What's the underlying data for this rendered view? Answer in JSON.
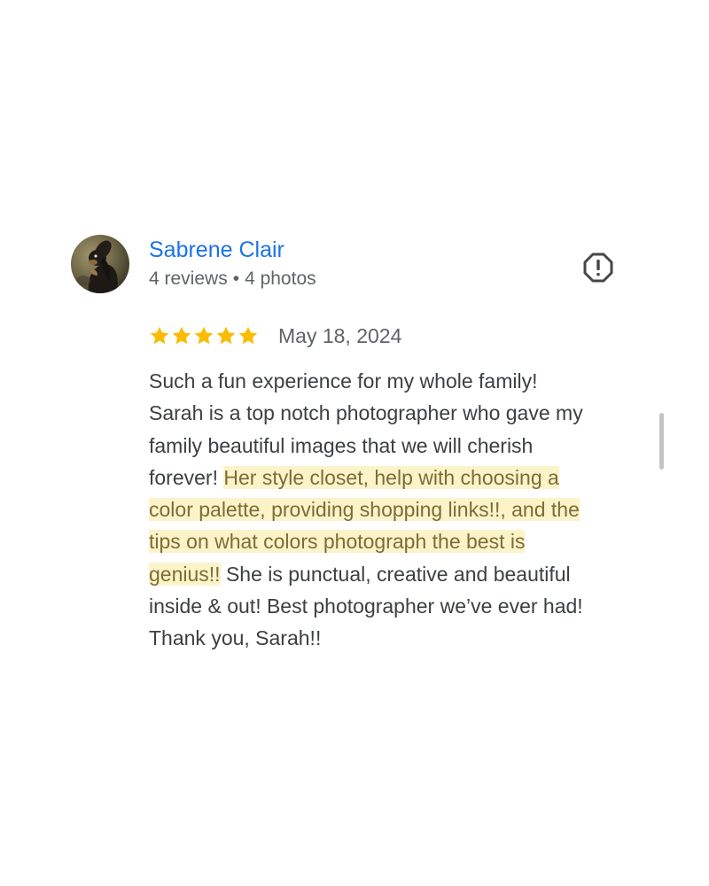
{
  "reviewer": {
    "name": "Sabrene Clair",
    "reviews": "4 reviews",
    "separator": "•",
    "photos": "4 photos",
    "avatar_icon": "avatar-dog-photo"
  },
  "report_icon": "report-exclamation-icon",
  "review": {
    "rating": 5,
    "rating_max": 5,
    "date": "May 18, 2024",
    "lines": [
      {
        "plain": "Such a fun experience for my whole family!",
        "highlight": ""
      },
      {
        "plain": "Sarah is a top notch photographer who gave my",
        "highlight": ""
      },
      {
        "plain": "family beautiful images that we will cherish",
        "highlight": ""
      },
      {
        "plain": "forever! ",
        "highlight": "Her style closet, help with choosing a"
      },
      {
        "plain": "",
        "highlight": "color palette, providing shopping links!!, and the"
      },
      {
        "plain": "",
        "highlight": "tips on what colors photograph the best is"
      },
      {
        "plain": "genius!!",
        "highlight_first": true,
        "rest": " She is punctual, creative and beautiful"
      },
      {
        "plain": "inside & out! Best photographer we’ve ever had!",
        "highlight": ""
      },
      {
        "plain": "Thank you, Sarah!!",
        "highlight": ""
      }
    ]
  },
  "colors": {
    "name_link": "#1a73e8",
    "star": "#fbbc04",
    "highlight_bg": "#fdf3c9",
    "highlight_text": "#7a6d36",
    "body_text": "#3c4043",
    "meta_text": "#5f6368"
  }
}
